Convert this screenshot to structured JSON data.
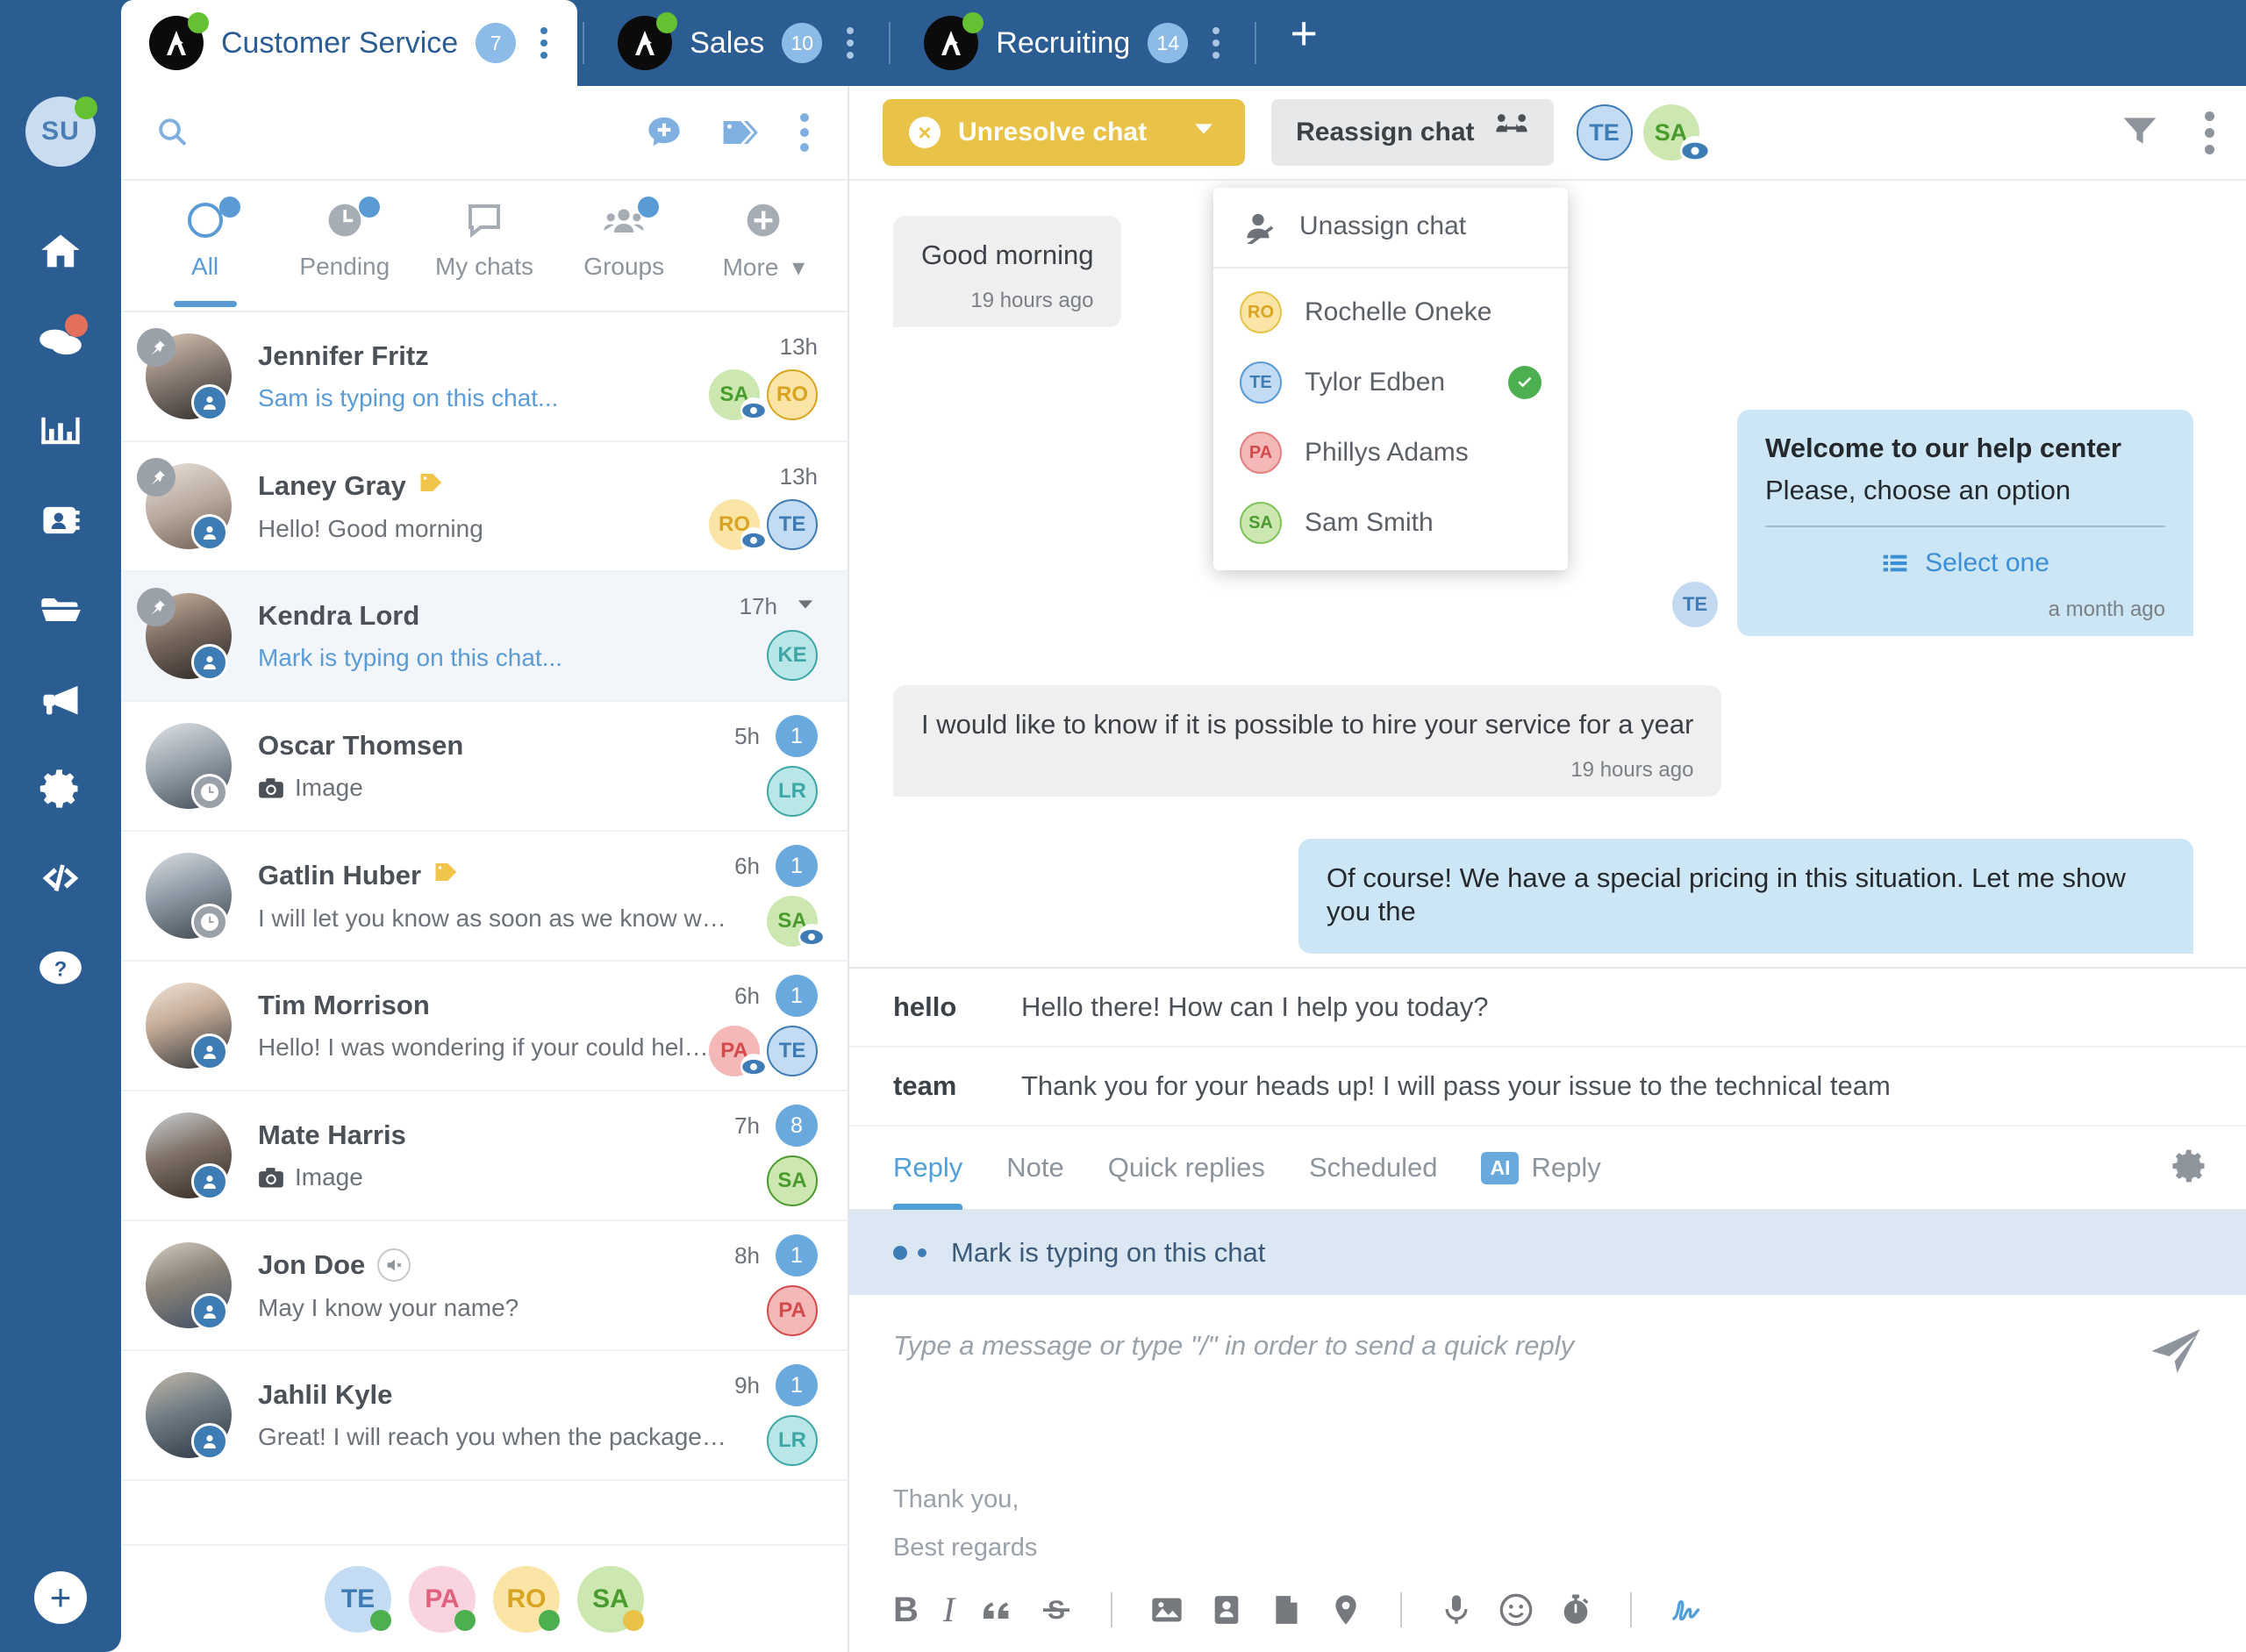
{
  "topbar": {
    "tabs": [
      {
        "label": "Customer Service",
        "badge": "7",
        "active": true
      },
      {
        "label": "Sales",
        "badge": "10",
        "active": false
      },
      {
        "label": "Recruiting",
        "badge": "14",
        "active": false
      }
    ],
    "add_tab_label": "+"
  },
  "rail": {
    "avatar_initials": "SU",
    "items": [
      {
        "name": "home-icon",
        "label": "Home"
      },
      {
        "name": "chats-icon",
        "label": "Chats"
      },
      {
        "name": "analytics-icon",
        "label": "Analytics"
      },
      {
        "name": "contacts-icon",
        "label": "Contacts"
      },
      {
        "name": "files-icon",
        "label": "Files"
      },
      {
        "name": "campaigns-icon",
        "label": "Campaigns"
      },
      {
        "name": "settings-icon",
        "label": "Settings"
      },
      {
        "name": "developers-icon",
        "label": "Developers"
      },
      {
        "name": "help-icon",
        "label": "Help"
      }
    ],
    "add_label": "+"
  },
  "list": {
    "search_icon": "search-icon",
    "header_icons": [
      "new-chat-icon",
      "tags-icon",
      "more-options-icon"
    ],
    "filters": [
      {
        "label": "All",
        "active": true,
        "dot": true,
        "icon": "circle-icon"
      },
      {
        "label": "Pending",
        "active": false,
        "dot": true,
        "icon": "clock-icon"
      },
      {
        "label": "My chats",
        "active": false,
        "dot": false,
        "icon": "chat-bubble-icon"
      },
      {
        "label": "Groups",
        "active": false,
        "dot": true,
        "icon": "group-icon"
      },
      {
        "label": "More",
        "active": false,
        "dot": false,
        "icon": "plus-circle-icon"
      }
    ],
    "chats": [
      {
        "name": "Jennifer Fritz",
        "preview": "Sam is typing on this chat...",
        "typing": true,
        "time": "13h",
        "pinned": true,
        "status": "user",
        "tag": false,
        "muted": false,
        "image_preview": false,
        "count": null,
        "chevron": false,
        "avatar_bg": "#8a7d74",
        "badges": [
          {
            "initials": "SA",
            "bg": "#cce7b0",
            "fg": "#4a9b2e",
            "eye": true,
            "outline": false
          },
          {
            "initials": "RO",
            "bg": "#fbe5a6",
            "fg": "#d8a422",
            "eye": false,
            "outline": true
          }
        ]
      },
      {
        "name": "Laney Gray",
        "preview": "Hello! Good morning",
        "typing": false,
        "time": "13h",
        "pinned": true,
        "status": "user",
        "tag": true,
        "muted": false,
        "image_preview": false,
        "count": null,
        "chevron": false,
        "avatar_bg": "#b9a99e",
        "badges": [
          {
            "initials": "RO",
            "bg": "#fbe5a6",
            "fg": "#d8a422",
            "eye": true,
            "outline": false
          },
          {
            "initials": "TE",
            "bg": "#c3dcf3",
            "fg": "#3d7cb5",
            "eye": false,
            "outline": true
          }
        ]
      },
      {
        "name": "Kendra Lord",
        "preview": "Mark is typing on this chat...",
        "typing": true,
        "time": "17h",
        "pinned": true,
        "status": "user",
        "tag": false,
        "muted": false,
        "image_preview": false,
        "count": null,
        "chevron": true,
        "selected": true,
        "avatar_bg": "#7a6a60",
        "badges": [
          {
            "initials": "KE",
            "bg": "#b9e6e6",
            "fg": "#3fa6a6",
            "eye": false,
            "outline": true
          }
        ]
      },
      {
        "name": "Oscar Thomsen",
        "preview": "Image",
        "typing": false,
        "time": "5h",
        "pinned": false,
        "status": "clock",
        "tag": false,
        "muted": false,
        "image_preview": true,
        "count": "1",
        "chevron": false,
        "avatar_bg": "#9aa4ad",
        "badges": [
          {
            "initials": "LR",
            "bg": "#b9e6e6",
            "fg": "#3fa6a6",
            "eye": false,
            "outline": true
          }
        ]
      },
      {
        "name": "Gatlin Huber",
        "preview": "I will let you know as soon as we know w…",
        "typing": false,
        "time": "6h",
        "pinned": false,
        "status": "clock",
        "tag": true,
        "muted": false,
        "image_preview": false,
        "count": "1",
        "chevron": false,
        "avatar_bg": "#8d9aa5",
        "badges": [
          {
            "initials": "SA",
            "bg": "#cce7b0",
            "fg": "#4a9b2e",
            "eye": true,
            "outline": false
          }
        ]
      },
      {
        "name": "Tim Morrison",
        "preview": "Hello! I was wondering if your could hel…",
        "typing": false,
        "time": "6h",
        "pinned": false,
        "status": "user",
        "tag": false,
        "muted": false,
        "image_preview": false,
        "count": "1",
        "chevron": false,
        "avatar_bg": "#d8c9bd",
        "badges": [
          {
            "initials": "PA",
            "bg": "#f5b8b8",
            "fg": "#d14b4b",
            "eye": true,
            "outline": false
          },
          {
            "initials": "TE",
            "bg": "#c3dcf3",
            "fg": "#3d7cb5",
            "eye": false,
            "outline": true
          }
        ]
      },
      {
        "name": "Mate Harris",
        "preview": "Image",
        "typing": false,
        "time": "7h",
        "pinned": false,
        "status": "user",
        "tag": false,
        "muted": false,
        "image_preview": true,
        "count": "8",
        "chevron": false,
        "avatar_bg": "#7e7066",
        "badges": [
          {
            "initials": "SA",
            "bg": "#cce7b0",
            "fg": "#4a9b2e",
            "eye": false,
            "outline": true
          }
        ]
      },
      {
        "name": "Jon Doe",
        "preview": "May I know your name?",
        "typing": false,
        "time": "8h",
        "pinned": false,
        "status": "user",
        "tag": false,
        "muted": true,
        "image_preview": false,
        "count": "1",
        "chevron": false,
        "avatar_bg": "#8c8478",
        "badges": [
          {
            "initials": "PA",
            "bg": "#f5b8b8",
            "fg": "#d14b4b",
            "eye": false,
            "outline": true
          }
        ]
      },
      {
        "name": "Jahlil Kyle",
        "preview": "Great! I will reach you when the package…",
        "typing": false,
        "time": "9h",
        "pinned": false,
        "status": "user",
        "tag": false,
        "muted": false,
        "image_preview": false,
        "count": "1",
        "chevron": false,
        "avatar_bg": "#6e7b84",
        "badges": [
          {
            "initials": "LR",
            "bg": "#b9e6e6",
            "fg": "#3fa6a6",
            "eye": false,
            "outline": true
          }
        ]
      }
    ],
    "footer_agents": [
      {
        "initials": "TE",
        "bg": "#c3dcf3",
        "fg": "#3d7cb5",
        "presence": "#4caf50"
      },
      {
        "initials": "PA",
        "bg": "#f9d3dd",
        "fg": "#e0607f",
        "presence": "#4caf50"
      },
      {
        "initials": "RO",
        "bg": "#fbe5a6",
        "fg": "#d8a422",
        "presence": "#4caf50"
      },
      {
        "initials": "SA",
        "bg": "#cce7b0",
        "fg": "#4a9b2e",
        "presence": "#e8c348"
      }
    ]
  },
  "conv_header": {
    "unresolve_label": "Unresolve chat",
    "reassign_label": "Reassign chat",
    "assigned": [
      {
        "initials": "TE",
        "bg": "#c3dcf3",
        "fg": "#3d7cb5",
        "eye": false,
        "outline": true
      },
      {
        "initials": "SA",
        "bg": "#cce7b0",
        "fg": "#4a9b2e",
        "eye": true,
        "outline": false
      }
    ],
    "filter_icon": "filter-icon",
    "more_icon": "more-options-icon"
  },
  "reassign_dropdown": {
    "unassign_label": "Unassign chat",
    "agents": [
      {
        "name": "Rochelle Oneke",
        "initials": "RO",
        "bg": "#fbe5a6",
        "fg": "#d8a422",
        "selected": false
      },
      {
        "name": "Tylor Edben",
        "initials": "TE",
        "bg": "#c3dcf3",
        "fg": "#3d7cb5",
        "selected": true
      },
      {
        "name": "Phillys Adams",
        "initials": "PA",
        "bg": "#f5b8b8",
        "fg": "#d14b4b",
        "selected": false
      },
      {
        "name": "Sam Smith",
        "initials": "SA",
        "bg": "#cce7b0",
        "fg": "#4a9b2e",
        "selected": false
      }
    ]
  },
  "messages": [
    {
      "dir": "in",
      "text": "Good morning",
      "time": "19 hours ago"
    },
    {
      "dir": "out",
      "kind": "card",
      "title": "Welcome to our help center",
      "subtitle": "Please, choose an option",
      "action": "Select one",
      "time": "a month ago",
      "avatar": {
        "initials": "TE",
        "bg": "#c3d9ef",
        "fg": "#3d7cb5"
      }
    },
    {
      "dir": "in",
      "text": "I would like to know if it is possible to hire your service for a year",
      "time": "19 hours ago"
    },
    {
      "dir": "out",
      "text": "Of course! We have a special pricing in this situation. Let me show you the",
      "time": ""
    }
  ],
  "suggestions": [
    {
      "key": "hello",
      "text": "Hello there! How can I help you today?"
    },
    {
      "key": "team",
      "text": "Thank you for your heads up! I will pass your issue to the technical team"
    }
  ],
  "composer_tabs": [
    {
      "label": "Reply",
      "active": true,
      "ai": false
    },
    {
      "label": "Note",
      "active": false,
      "ai": false
    },
    {
      "label": "Quick replies",
      "active": false,
      "ai": false
    },
    {
      "label": "Scheduled",
      "active": false,
      "ai": false
    },
    {
      "label": "Reply",
      "active": false,
      "ai": true,
      "ai_label": "AI"
    }
  ],
  "typing_banner": "Mark is typing on this chat",
  "composer": {
    "placeholder": "Type a message or type \"/\" in order to send a quick reply",
    "signature_line1": "Thank you,",
    "signature_line2": "Best regards",
    "send_icon": "send-icon",
    "toolbar": [
      {
        "name": "bold-icon",
        "glyph": "B"
      },
      {
        "name": "italic-icon",
        "glyph": "I"
      },
      {
        "name": "quote-icon",
        "glyph": "””"
      },
      {
        "name": "strikethrough-icon",
        "glyph": "S"
      },
      {
        "name": "divider-1",
        "glyph": "|"
      },
      {
        "name": "image-icon",
        "glyph": ""
      },
      {
        "name": "contact-card-icon",
        "glyph": ""
      },
      {
        "name": "document-icon",
        "glyph": ""
      },
      {
        "name": "location-icon",
        "glyph": ""
      },
      {
        "name": "divider-2",
        "glyph": "|"
      },
      {
        "name": "microphone-icon",
        "glyph": ""
      },
      {
        "name": "emoji-icon",
        "glyph": ""
      },
      {
        "name": "timer-icon",
        "glyph": ""
      },
      {
        "name": "divider-3",
        "glyph": "|"
      },
      {
        "name": "signature-icon",
        "glyph": ""
      }
    ]
  }
}
